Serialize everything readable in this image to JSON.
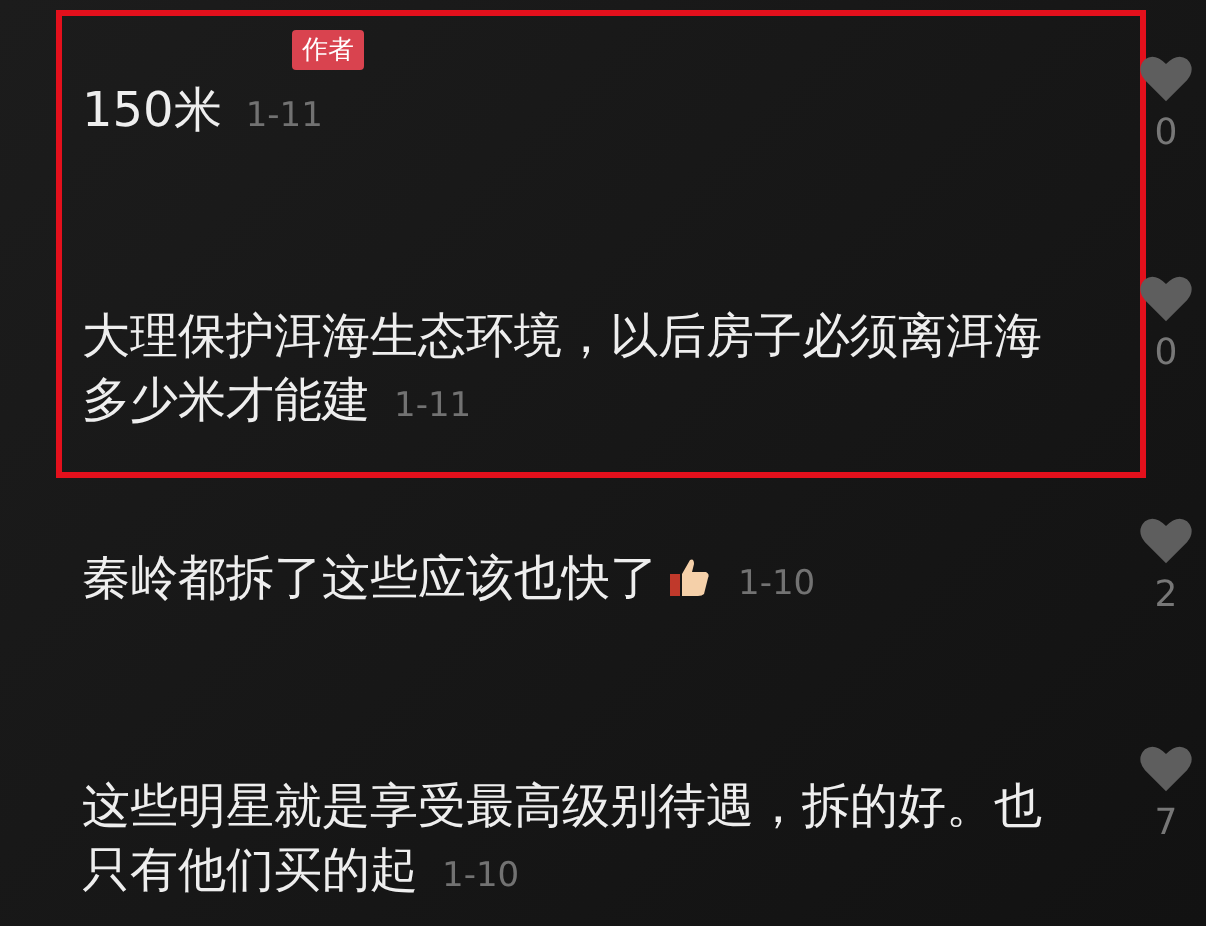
{
  "highlighted_group": {
    "comments": [
      {
        "author_badge": "作者",
        "text": "150米",
        "thumb_icon": false,
        "date": "1-11",
        "likes": "0"
      },
      {
        "text": "大理保护洱海生态环境，以后房子必须离洱海多少米才能建",
        "thumb_icon": false,
        "date": "1-11",
        "likes": "0"
      }
    ]
  },
  "comments": [
    {
      "text": "秦岭都拆了这些应该也快了",
      "thumb_icon": true,
      "date": "1-10",
      "likes": "2"
    },
    {
      "text": "这些明星就是享受最高级别待遇，拆的好。也只有他们买的起",
      "thumb_icon": false,
      "date": "1-10",
      "likes": "7"
    }
  ]
}
